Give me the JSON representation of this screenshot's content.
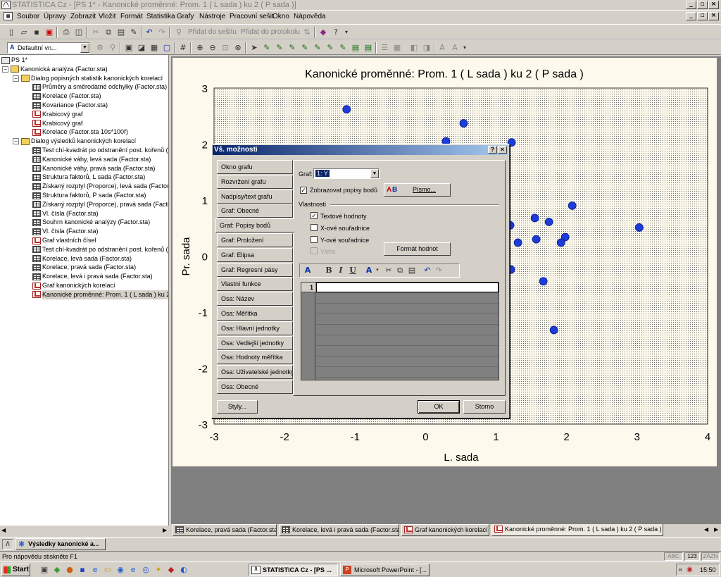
{
  "window": {
    "title": "STATISTICA Cz - [PS 1* - Kanonické proměnné: Prom.   1 ( L sada ) ku   2 ( P sada )]"
  },
  "menu": [
    "Soubor",
    "Úpravy",
    "Zobrazit",
    "Vložit",
    "Formát",
    "Statistika",
    "Grafy",
    "Nástroje",
    "Pracovní sešit",
    "Okno",
    "Nápověda"
  ],
  "toolbar": {
    "add_workbook": "Přidat do sešitu",
    "add_protocol": "Přidat do protokolu",
    "style_combo": "Defaultní vn..."
  },
  "tree": {
    "root": "PS 1*",
    "analysis": "Kanonická analýza (Factor.sta)",
    "group1": "Dialog popisných statistik kanonických korelací",
    "group1_items": [
      {
        "label": "Průměry a směrodatné odchylky (Factor.sta)",
        "icon": "sheet"
      },
      {
        "label": "Korelace (Factor.sta)",
        "icon": "sheet"
      },
      {
        "label": "Kovariance (Factor.sta)",
        "icon": "sheet"
      },
      {
        "label": "Krabicový graf",
        "icon": "graph"
      },
      {
        "label": "Krabicový graf",
        "icon": "graph"
      },
      {
        "label": "Korelace (Factor.sta 10s*100ř)",
        "icon": "graph"
      }
    ],
    "group2": "Dialog výsledků kanonických korelací",
    "group2_items": [
      {
        "label": "Test chí-kvadrát po odstranění post. kořenů (F",
        "icon": "sheet"
      },
      {
        "label": "Kanonické váhy, levá sada (Factor.sta)",
        "icon": "sheet"
      },
      {
        "label": "Kanonické váhy, pravá sada (Factor.sta)",
        "icon": "sheet"
      },
      {
        "label": "Struktura faktorů, L sada (Factor.sta)",
        "icon": "sheet"
      },
      {
        "label": "Získaný rozptyl (Proporce), levá sada (Factor.",
        "icon": "sheet"
      },
      {
        "label": "Struktura faktorů, P sada (Factor.sta)",
        "icon": "sheet"
      },
      {
        "label": "Získaný rozptyl (Proporce), pravá sada (Facto",
        "icon": "sheet"
      },
      {
        "label": "Vl. čísla (Factor.sta)",
        "icon": "sheet"
      },
      {
        "label": "Souhrn kanonické analýzy (Factor.sta)",
        "icon": "sheet"
      },
      {
        "label": "Vl. čísla (Factor.sta)",
        "icon": "sheet"
      },
      {
        "label": "Graf vlastních čísel",
        "icon": "graph"
      },
      {
        "label": "Test chí-kvadrát po odstranění post. kořenů (F",
        "icon": "sheet"
      },
      {
        "label": "Korelace, levá sada (Factor.sta)",
        "icon": "sheet"
      },
      {
        "label": "Korelace, pravá sada (Factor.sta)",
        "icon": "sheet"
      },
      {
        "label": "Korelace, levá i pravá sada (Factor.sta)",
        "icon": "sheet"
      },
      {
        "label": "Graf kanonických korelací",
        "icon": "graph"
      },
      {
        "label": "Kanonické proměnné: Prom.   1 ( L sada ) ku  2",
        "icon": "graph",
        "selected": true
      }
    ]
  },
  "chart_data": {
    "type": "scatter",
    "title": "Kanonické proměnné: Prom.   1 ( L sada ) ku   2 ( P sada )",
    "xlabel": "L. sada",
    "ylabel": "Pr. sada",
    "xlim": [
      -3,
      4
    ],
    "ylim": [
      -3,
      3
    ],
    "xticks": [
      "-3",
      "-2",
      "-1",
      "0",
      "1",
      "2",
      "3",
      "4"
    ],
    "yticks": [
      "3",
      "2",
      "1",
      "0",
      "-1",
      "-2",
      "-3"
    ],
    "marker_color": "#1c3cd8",
    "points": [
      {
        "x": -1.12,
        "y": 2.62
      },
      {
        "x": 0.54,
        "y": 2.37
      },
      {
        "x": 0.29,
        "y": 2.05
      },
      {
        "x": 1.22,
        "y": 2.03
      },
      {
        "x": 2.08,
        "y": 0.9
      },
      {
        "x": 1.55,
        "y": 0.68
      },
      {
        "x": 1.75,
        "y": 0.61
      },
      {
        "x": 1.2,
        "y": 0.55
      },
      {
        "x": 3.03,
        "y": 0.51
      },
      {
        "x": 1.98,
        "y": 0.34
      },
      {
        "x": 1.57,
        "y": 0.3
      },
      {
        "x": 1.31,
        "y": 0.24
      },
      {
        "x": 1.92,
        "y": 0.24
      },
      {
        "x": 1.21,
        "y": -0.24
      },
      {
        "x": 1.67,
        "y": -0.45
      },
      {
        "x": 1.82,
        "y": -1.32
      }
    ]
  },
  "dialog": {
    "title": "Vš. možnosti",
    "tabs": [
      "Okno grafu",
      "Rozvržení grafu",
      "Nadpisy/text grafu",
      "Graf: Obecné",
      "Graf: Popisy bodů",
      "Graf: Proložení",
      "Graf: Elipsa",
      "Graf: Regresní pásy",
      "Vlastní funkce",
      "Osa: Název",
      "Osa: Měřítka",
      "Osa: Hlavní jednotky",
      "Osa: Vedlejší jednotky",
      "Osa: Hodnoty měřítka",
      "Osa: Uživatelské jednotky",
      "Osa: Obecné"
    ],
    "graf_label": "Graf:",
    "graf_value": "1: Y",
    "show_labels": "Zobrazovat popisy bodů",
    "font_button": "Písmo...",
    "properties": "Vlastnosti",
    "text_values": "Textové hodnoty",
    "x_coords": "X-ové souřadnice",
    "y_coords": "Y-ové souřadnice",
    "weight": "Váha",
    "format_button": "Formát hodnot",
    "row_number": "1",
    "styles_button": "Styly...",
    "ok_button": "OK",
    "cancel_button": "Storno"
  },
  "doc_tabs": [
    "Korelace, pravá sada (Factor.sta)",
    "Korelace, levá i pravá sada (Factor.sta)",
    "Graf kanonických korelací",
    "Kanonické proměnné: Prom.   1 ( L sada ) ku   2 ( P sada )"
  ],
  "results_window": "Výsledky kanonické a...",
  "status": {
    "help": "Pro nápovědu stiskněte F1",
    "abc": "ABC",
    "num": "123",
    "zazn": "ZÁZN"
  },
  "taskbar": {
    "start": "Start",
    "task1": "STATISTICA Cz - [PS ...",
    "task2": "Microsoft PowerPoint - [...",
    "clock": "15:50"
  }
}
